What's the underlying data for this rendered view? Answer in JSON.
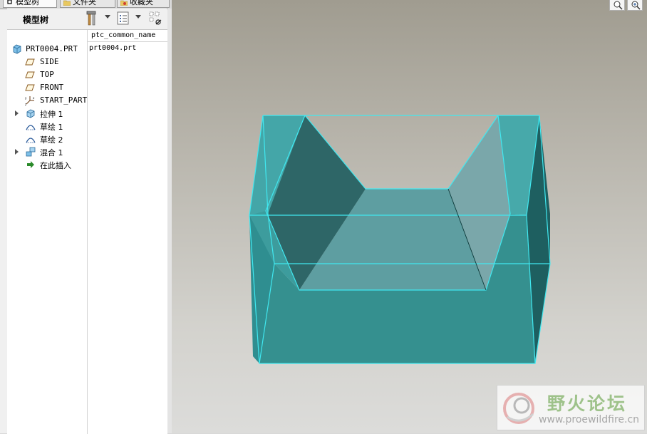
{
  "tabs": [
    {
      "label": "模型树",
      "active": true
    },
    {
      "label": "文件夹",
      "active": false
    },
    {
      "label": "收藏夹",
      "active": false
    }
  ],
  "toolbar": {
    "title": "模型树",
    "icons": [
      "settings-icon",
      "show-icon",
      "filter-icon"
    ]
  },
  "column_header": "ptc_common_name",
  "tree": [
    {
      "label": "PRT0004.PRT",
      "icon": "part-icon",
      "column_value": "prt0004.prt",
      "expandable": false,
      "level": 0
    },
    {
      "label": "SIDE",
      "icon": "datum-plane-icon",
      "column_value": "",
      "expandable": false,
      "level": 1
    },
    {
      "label": "TOP",
      "icon": "datum-plane-icon",
      "column_value": "",
      "expandable": false,
      "level": 1
    },
    {
      "label": "FRONT",
      "icon": "datum-plane-icon",
      "column_value": "",
      "expandable": false,
      "level": 1
    },
    {
      "label": "START_PART",
      "icon": "coordinate-system-icon",
      "column_value": "",
      "expandable": false,
      "level": 1
    },
    {
      "label": "拉伸 1",
      "icon": "extrude-icon",
      "column_value": "",
      "expandable": true,
      "level": 1
    },
    {
      "label": "草绘 1",
      "icon": "sketch-icon",
      "column_value": "",
      "expandable": false,
      "level": 1
    },
    {
      "label": "草绘 2",
      "icon": "sketch-icon",
      "column_value": "",
      "expandable": false,
      "level": 1
    },
    {
      "label": "混合 1",
      "icon": "blend-icon",
      "column_value": "",
      "expandable": true,
      "level": 1
    },
    {
      "label": "在此插入",
      "icon": "insert-here-icon",
      "column_value": "",
      "expandable": false,
      "level": 1
    }
  ],
  "viewport": {
    "buttons": [
      "zoom-fit-icon",
      "zoom-in-icon"
    ]
  },
  "watermark": {
    "cn_text": "野火论坛",
    "url": "www.proewildfire.cn"
  },
  "colors": {
    "model_face": "#3a9498",
    "model_edge": "#40e8f0",
    "model_dark": "#1d5d5f",
    "panel_bg": "#f0f0f0"
  }
}
